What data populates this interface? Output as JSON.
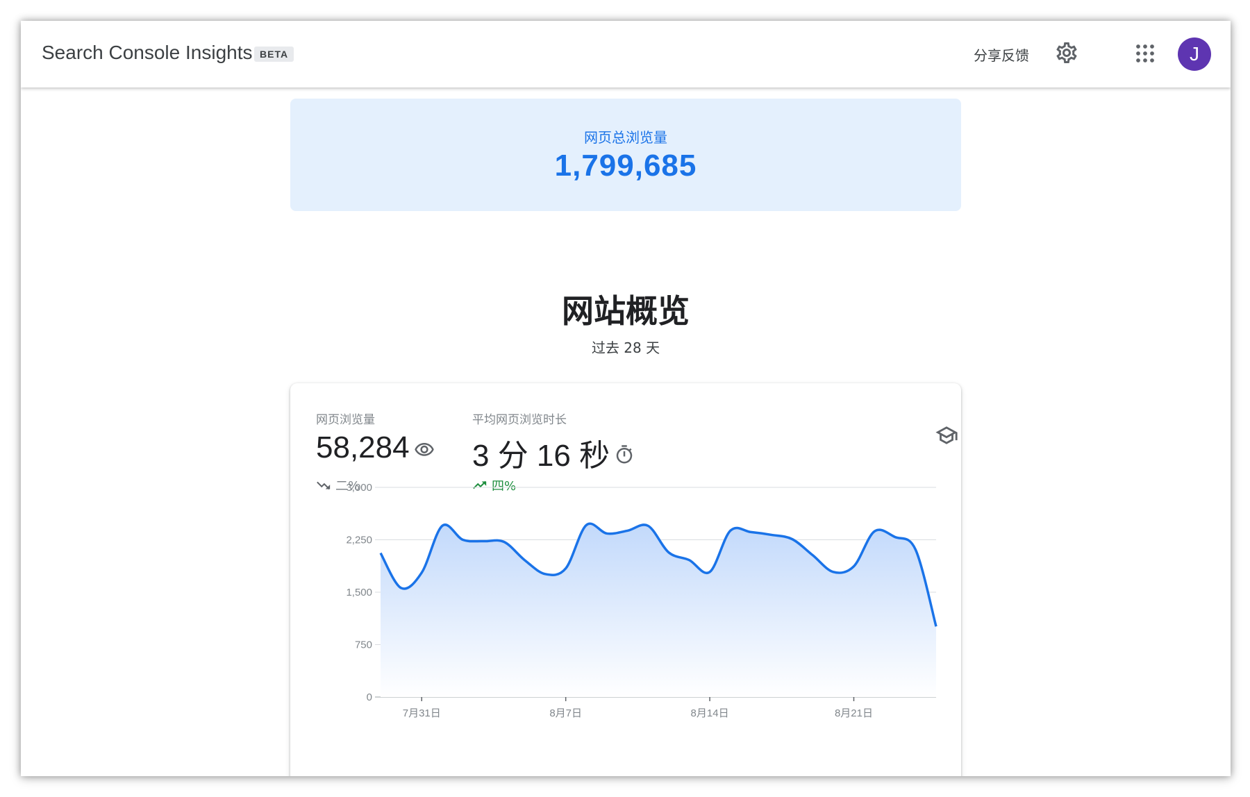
{
  "header": {
    "app_title": "Search Console Insights",
    "badge": "BETA",
    "feedback_label": "分享反馈",
    "avatar_initial": "J"
  },
  "summary": {
    "label": "网页总浏览量",
    "value": "1,799,685"
  },
  "overview": {
    "title": "网站概览",
    "subtitle": "过去 28 天"
  },
  "metrics": [
    {
      "label": "网页浏览量",
      "value": "58,284",
      "icon": "eye-icon",
      "trend": "二%",
      "trend_direction": "down"
    },
    {
      "label": "平均网页浏览时长",
      "value": "3 分 16 秒",
      "icon": "timer-icon",
      "trend": "四%",
      "trend_direction": "up"
    }
  ],
  "colors": {
    "accent": "#1a73e8",
    "summary_bg": "#e4f0fd",
    "trend_up": "#1e8e3e",
    "trend_down": "#80868b",
    "avatar_bg": "#5e35b1"
  },
  "chart_data": {
    "type": "area",
    "y_tick_labels": [
      "0",
      "750",
      "1,500",
      "2,250",
      "3,000"
    ],
    "ylim": [
      0,
      3000
    ],
    "x_tick_labels": [
      "7月31日",
      "8月7日",
      "8月14日",
      "8月21日"
    ],
    "x_tick_index": [
      2,
      9,
      16,
      23
    ],
    "grid": true,
    "values": [
      2060,
      1560,
      1780,
      2450,
      2250,
      2230,
      2220,
      1960,
      1760,
      1840,
      2460,
      2340,
      2380,
      2450,
      2070,
      1960,
      1790,
      2380,
      2360,
      2320,
      2260,
      2030,
      1790,
      1870,
      2370,
      2290,
      2110,
      1010
    ]
  }
}
